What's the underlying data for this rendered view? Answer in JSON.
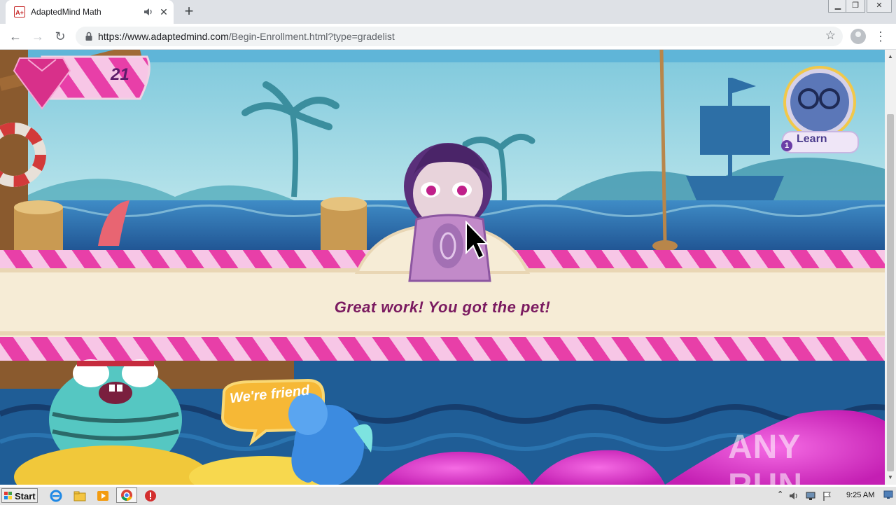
{
  "browser": {
    "tab": {
      "title": "AdaptedMind Math",
      "favicon_text": "A+"
    },
    "address": {
      "host": "https://www.adaptedmind.com",
      "path": "/Begin-Enrollment.html?type=gradelist"
    }
  },
  "game": {
    "gem_count": "21",
    "learn_label": "Learn",
    "learn_badge": "1",
    "message": "Great work! You got the pet!",
    "speech_bubble": "We're friend",
    "watermark": "ANY RUN"
  },
  "taskbar": {
    "start_label": "Start",
    "clock": "9:25 AM"
  },
  "colors": {
    "banner_stripe": "#e83fa8",
    "message_text": "#7a1a60",
    "sky": "#9fd6e2",
    "sea": "#2b6fa8",
    "gel": "#e32fd3"
  }
}
